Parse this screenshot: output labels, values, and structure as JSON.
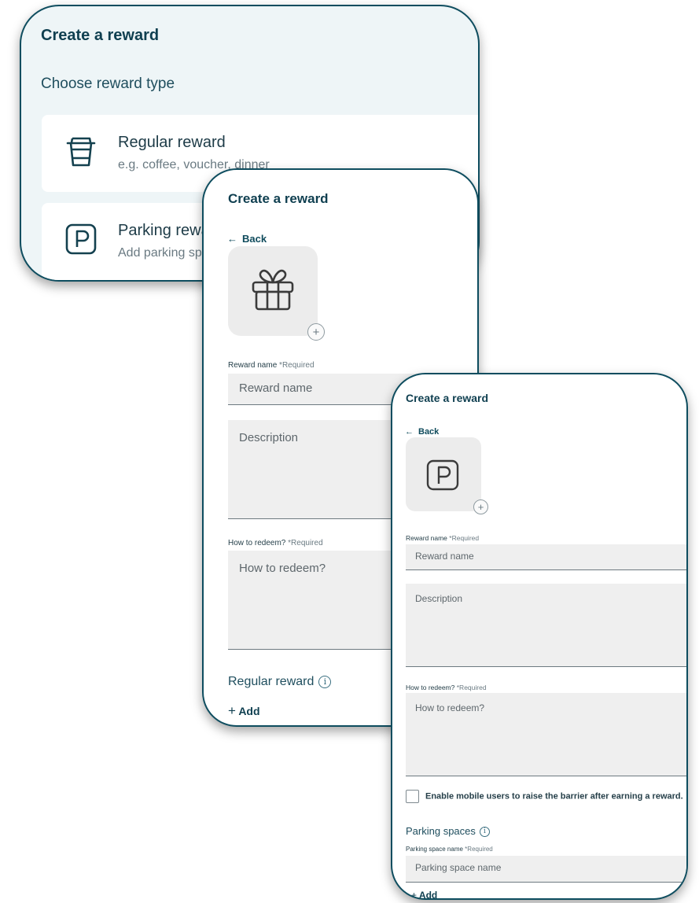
{
  "screen1": {
    "title": "Create a reward",
    "subtitle": "Choose reward type",
    "types": [
      {
        "title": "Regular reward",
        "subtitle": "e.g. coffee, voucher, dinner",
        "icon": "coffee-cup-icon"
      },
      {
        "title": "Parking reward",
        "subtitle": "Add parking spaces",
        "icon": "parking-icon"
      }
    ]
  },
  "screen2": {
    "title": "Create a reward",
    "back_arrow": "←",
    "back_label": "Back",
    "image_icon": "gift-icon",
    "add_image_symbol": "+",
    "reward_name_label": "Reward name",
    "reward_name_required": "*Required",
    "reward_name_placeholder": "Reward name",
    "description_placeholder": "Description",
    "redeem_label": "How to redeem?",
    "redeem_required": "*Required",
    "redeem_placeholder": "How to redeem?",
    "section_title": "Regular reward",
    "info_symbol": "i",
    "add_symbol": "+",
    "add_label": "Add"
  },
  "screen3": {
    "title": "Create a reward",
    "back_arrow": "←",
    "back_label": "Back",
    "image_icon": "parking-icon",
    "add_image_symbol": "+",
    "reward_name_label": "Reward name",
    "reward_name_required": "*Required",
    "reward_name_placeholder": "Reward name",
    "description_placeholder": "Description",
    "redeem_label": "How to redeem?",
    "redeem_required": "*Required",
    "redeem_placeholder": "How to redeem?",
    "checkbox_label": "Enable mobile users to raise the barrier after earning a reward.",
    "checkbox_checked": false,
    "section_title": "Parking spaces",
    "info_symbol": "i",
    "space_name_label": "Parking space name",
    "space_name_required": "*Required",
    "space_name_placeholder": "Parking space name",
    "add_symbol": "+",
    "add_label": "Add"
  },
  "colors": {
    "accent": "#0e4d5f",
    "screen1_background": "#eef5f7",
    "input_background": "#efefef"
  }
}
